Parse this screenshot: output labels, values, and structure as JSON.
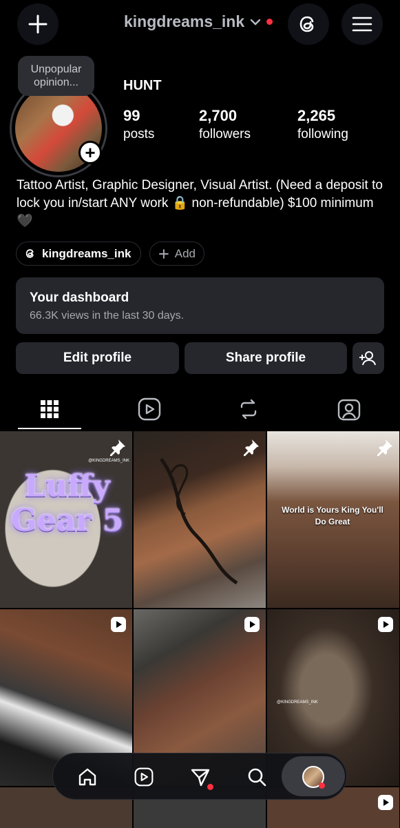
{
  "header": {
    "username": "kingdreams_ink",
    "icons": [
      "plus-icon",
      "chevron-down-icon",
      "threads-icon",
      "menu-icon"
    ]
  },
  "note": {
    "text": "Unpopular opinion..."
  },
  "profile": {
    "name": "HUNT",
    "stats": [
      {
        "value": "99",
        "label": "posts"
      },
      {
        "value": "2,700",
        "label": "followers"
      },
      {
        "value": "2,265",
        "label": "following"
      }
    ],
    "bio": "Tattoo Artist, Graphic Designer, Visual Artist. (Need a deposit to lock you in/start ANY work 🔒 non-refundable) $100 minimum 🖤",
    "threads_chip": "kingdreams_ink",
    "add_chip": "Add"
  },
  "dashboard": {
    "title": "Your dashboard",
    "subtitle": "66.3K views in the last 30 days."
  },
  "actions": {
    "edit": "Edit profile",
    "share": "Share profile"
  },
  "tabs": [
    "grid-icon",
    "reels-icon",
    "reposts-icon",
    "tagged-icon"
  ],
  "posts": [
    {
      "overlay": "Luffy Gear 5",
      "badge": "pin",
      "watermark": "@KINGDREAMS_INK"
    },
    {
      "overlay": "",
      "badge": "pin",
      "watermark": ""
    },
    {
      "overlay": "World is Yours King You'll Do Great",
      "badge": "pin",
      "watermark": ""
    },
    {
      "overlay": "",
      "badge": "reel",
      "watermark": ""
    },
    {
      "overlay": "",
      "badge": "reel",
      "watermark": ""
    },
    {
      "overlay": "",
      "badge": "",
      "watermark": "@KINGDREAMS_INK"
    }
  ],
  "colors": {
    "background": "#000000",
    "surface": "#25272d",
    "notification": "#ff3040"
  }
}
